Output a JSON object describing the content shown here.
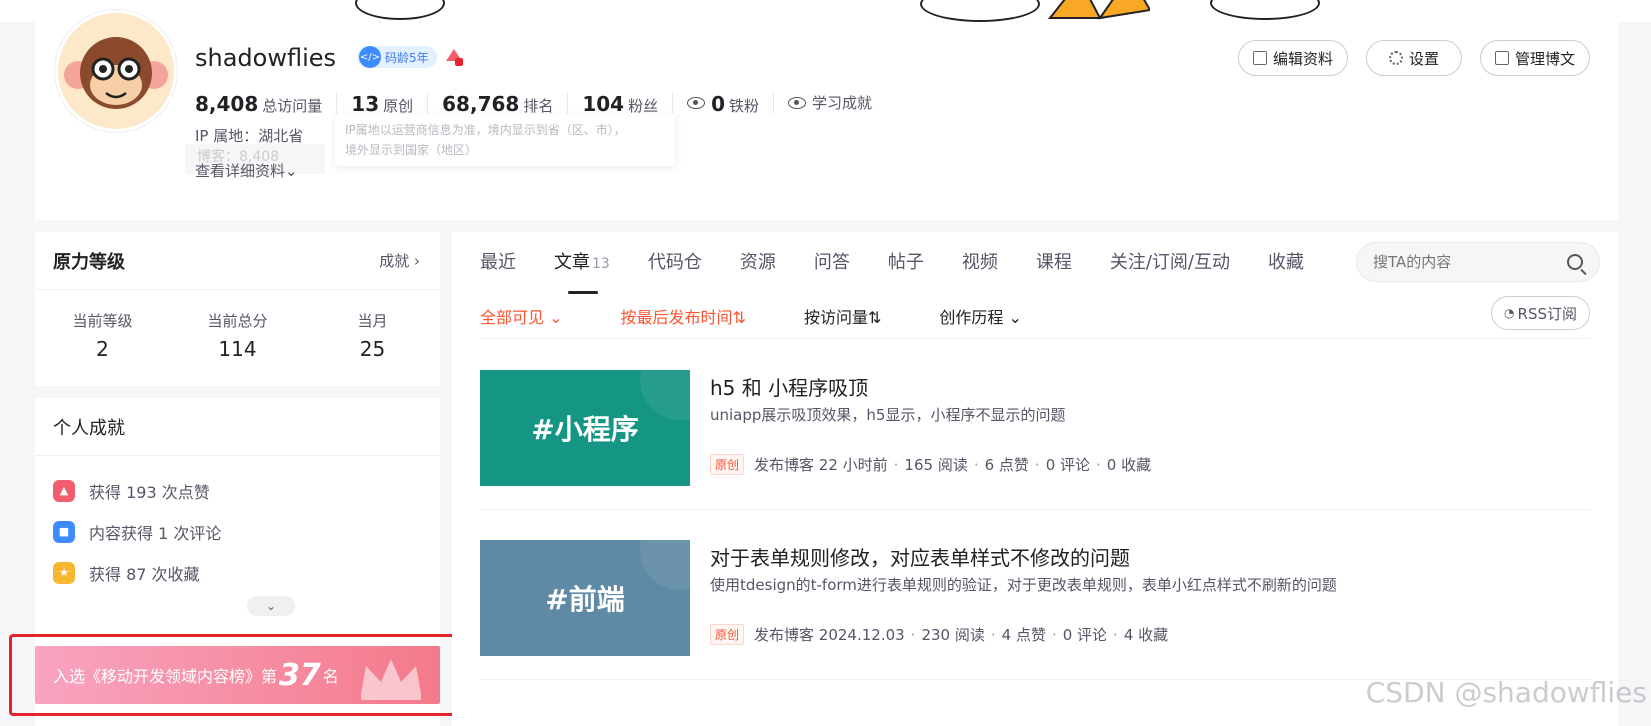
{
  "profile": {
    "nickname": "shadowflies",
    "code_age": "码龄5年",
    "stats": [
      {
        "num": "8,408",
        "label": "总访问量"
      },
      {
        "num": "13",
        "label": "原创"
      },
      {
        "num": "68,768",
        "label": "排名"
      },
      {
        "num": "104",
        "label": "粉丝"
      },
      {
        "num": "0",
        "label": "铁粉"
      }
    ],
    "learning": "学习成就",
    "ip": "IP 属地：湖北省",
    "ip_tip_line1": "IP属地以运营商信息为准，境内显示到省（区、市），",
    "ip_tip_line2": "境外显示到国家（地区）",
    "blog_ghost": "博客：8,408",
    "more_info": "查看详细资料"
  },
  "buttons": {
    "edit": "编辑资料",
    "settings": "设置",
    "manage": "管理博文"
  },
  "level": {
    "title": "原力等级",
    "link": "成就",
    "items": [
      {
        "label": "当前等级",
        "value": "2"
      },
      {
        "label": "当前总分",
        "value": "114"
      },
      {
        "label": "当月",
        "value": "25"
      }
    ]
  },
  "achievements": {
    "title": "个人成就",
    "items": [
      {
        "text": "获得 193 次点赞",
        "color": "#f25e6d"
      },
      {
        "text": "内容获得 1 次评论",
        "color": "#3d8bff"
      },
      {
        "text": "获得 87 次收藏",
        "color": "#f7b731"
      }
    ],
    "rank_prefix": "入选《移动开发领域内容榜》第",
    "rank_num": "37",
    "rank_suffix": "名"
  },
  "tabs": [
    {
      "label": "最近"
    },
    {
      "label": "文章",
      "count": "13",
      "active": true
    },
    {
      "label": "代码仓"
    },
    {
      "label": "资源"
    },
    {
      "label": "问答"
    },
    {
      "label": "帖子"
    },
    {
      "label": "视频"
    },
    {
      "label": "课程"
    },
    {
      "label": "关注/订阅/互动"
    },
    {
      "label": "收藏"
    }
  ],
  "search": {
    "placeholder": "搜TA的内容"
  },
  "filters": {
    "visibility": "全部可见",
    "sort_time": "按最后发布时间⇅",
    "sort_views": "按访问量⇅",
    "history": "创作历程",
    "rss": "RSS订阅"
  },
  "articles": [
    {
      "thumb": "#小程序",
      "title": "h5 和 小程序吸顶",
      "desc": "uniapp展示吸顶效果，h5显示，小程序不显示的问题",
      "tag": "原创",
      "time": "发布博客 22 小时前",
      "reads": "165 阅读",
      "likes": "6 点赞",
      "comments": "0 评论",
      "favs": "0 收藏"
    },
    {
      "thumb": "#前端",
      "title": "对于表单规则修改，对应表单样式不修改的问题",
      "desc": "使用tdesign的t-form进行表单规则的验证，对于更改表单规则，表单小红点样式不刷新的问题",
      "tag": "原创",
      "time": "发布博客 2024.12.03",
      "reads": "230 阅读",
      "likes": "4 点赞",
      "comments": "0 评论",
      "favs": "4 收藏"
    }
  ],
  "watermark": "CSDN @shadowflies"
}
